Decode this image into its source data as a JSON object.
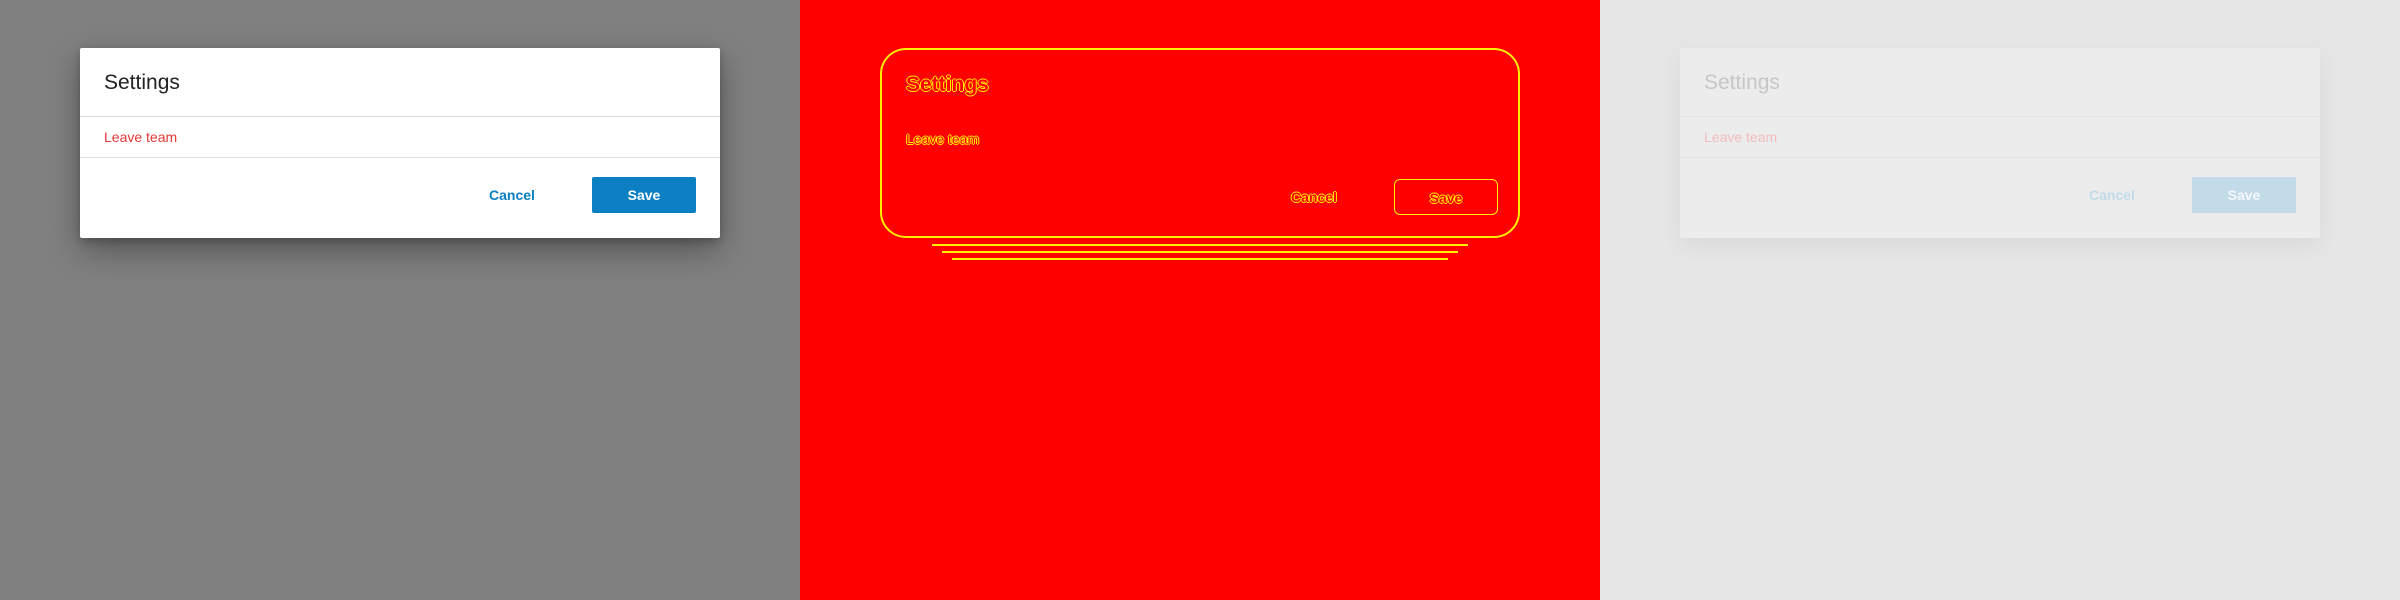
{
  "dialog": {
    "title": "Settings",
    "leave_link": "Leave team",
    "cancel_label": "Cancel",
    "save_label": "Save"
  },
  "colors": {
    "overlay": "#808080",
    "dialog_background": "#ffffff",
    "title_text": "#212121",
    "danger_link": "#e53935",
    "primary_accent": "#0b7fc2",
    "edge_background": "#ff0000",
    "edge_lines": "#ffee00",
    "faded_background": "#e6e6e6"
  }
}
